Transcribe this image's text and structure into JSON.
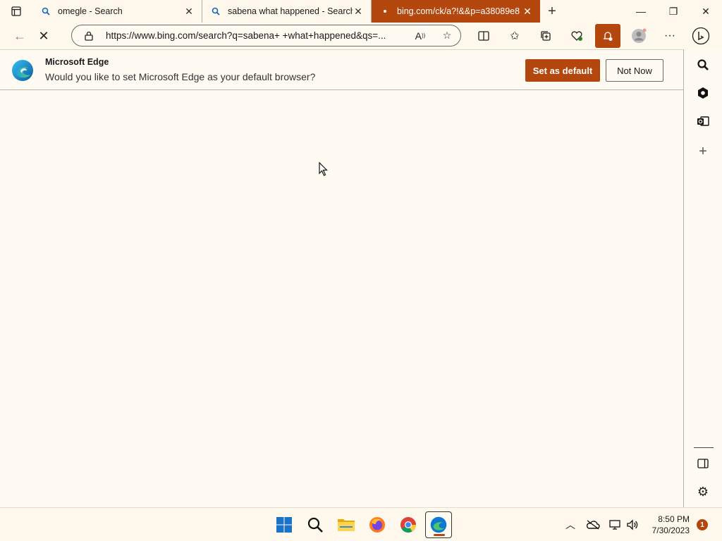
{
  "tabs": [
    {
      "title": "omegle - Search",
      "active": false
    },
    {
      "title": "sabena what happened - Search",
      "active": false
    },
    {
      "title": "bing.com/ck/a?!&&p=a38089e8",
      "active": true
    }
  ],
  "address_bar": {
    "url": "https://www.bing.com/search?q=sabena+ +what+happened&qs=..."
  },
  "infobar": {
    "title": "Microsoft Edge",
    "message": "Would you like to set Microsoft Edge as your default browser?",
    "primary_button": "Set as default",
    "secondary_button": "Not Now"
  },
  "taskbar": {
    "clock_time": "8:50 PM",
    "clock_date": "7/30/2023",
    "notification_count": "1"
  },
  "colors": {
    "accent": "#b3470e",
    "background": "#fffbf2"
  }
}
